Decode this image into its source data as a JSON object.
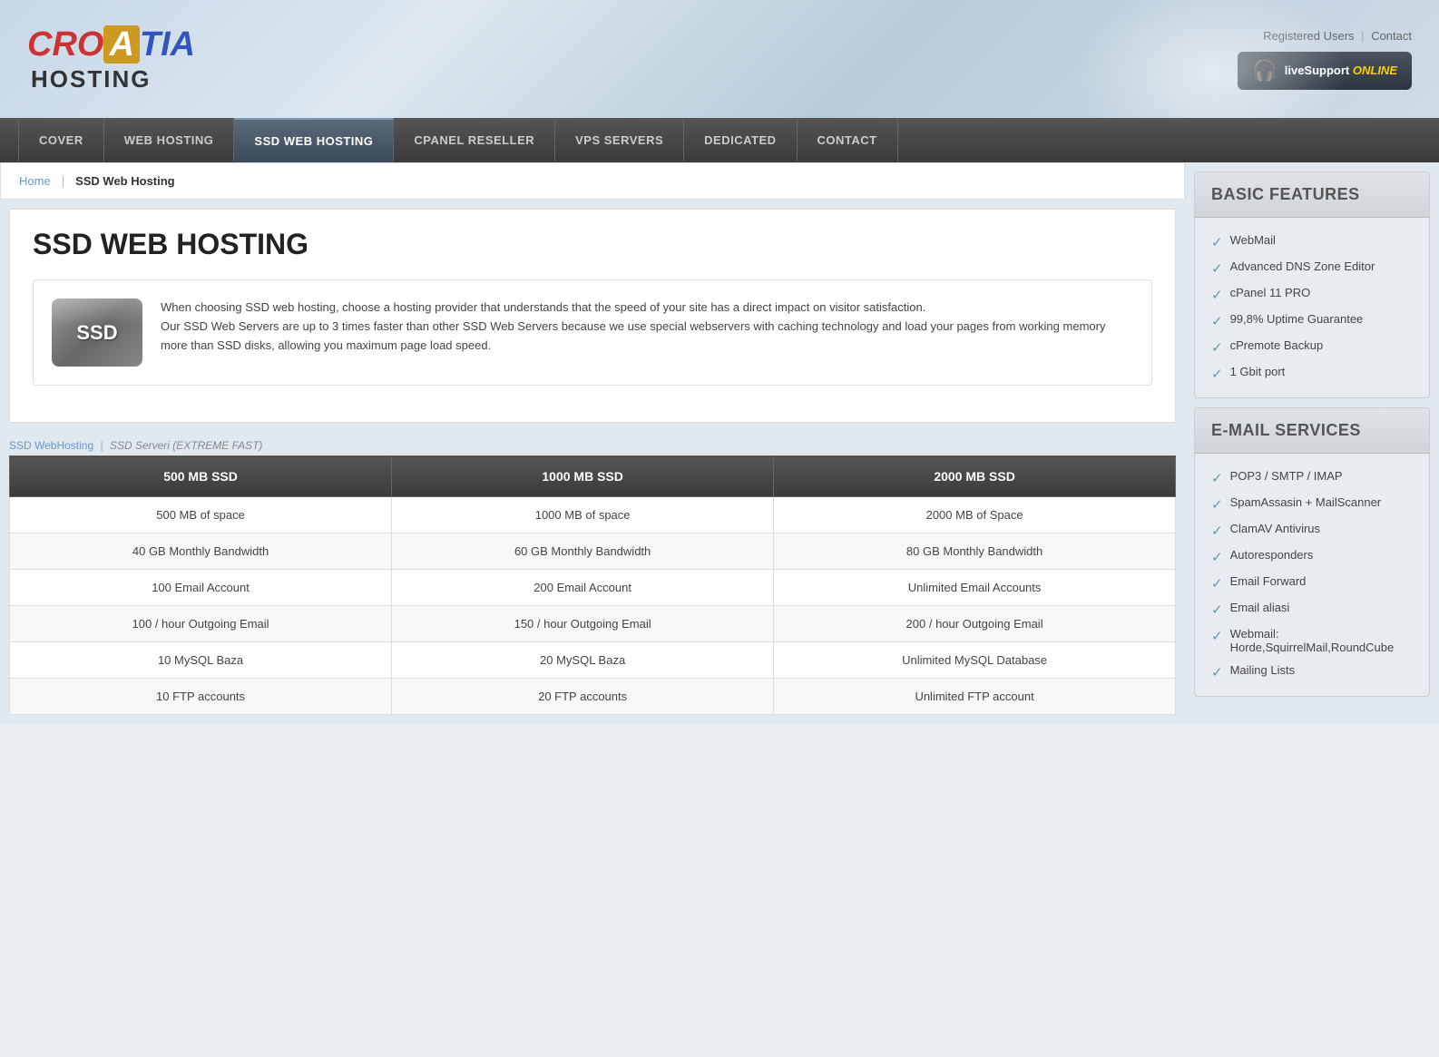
{
  "header": {
    "logo": {
      "cro": "CRO",
      "a": "A",
      "tia": "TIA",
      "hosting": "HOSTING"
    },
    "links": {
      "registered": "Registered Users",
      "separator": "|",
      "contact": "Contact"
    },
    "livesupport": {
      "label": "liveSupport",
      "status": "ONLINE"
    }
  },
  "nav": {
    "items": [
      {
        "label": "COVER",
        "active": false
      },
      {
        "label": "WEB HOSTING",
        "active": false
      },
      {
        "label": "SSD WEB HOSTING",
        "active": true
      },
      {
        "label": "CPANEL RESELLER",
        "active": false
      },
      {
        "label": "VPS SERVERS",
        "active": false
      },
      {
        "label": "DEDICATED",
        "active": false
      },
      {
        "label": "CONTACT",
        "active": false
      }
    ]
  },
  "breadcrumb": {
    "home": "Home",
    "current": "SSD Web Hosting"
  },
  "main": {
    "title": "SSD WEB HOSTING",
    "intro": {
      "icon_text": "SSD",
      "text": "When choosing SSD web hosting, choose a hosting provider that understands that the speed of your site has a direct impact on visitor satisfaction.\nOur SSD Web Servers are up to 3 times faster than other SSD Web Servers because we use special webservers with caching technology and load your pages from working memory more than SSD disks, allowing you maximum page load speed."
    },
    "table_links": {
      "link1": "SSD WebHosting",
      "separator": "|",
      "link2": "SSD Serveri (EXTREME FAST)"
    },
    "table": {
      "headers": [
        "500 MB SSD",
        "1000 MB SSD",
        "2000 MB SSD"
      ],
      "rows": [
        [
          "500 MB of space",
          "1000 MB of space",
          "2000 MB of Space"
        ],
        [
          "40 GB Monthly Bandwidth",
          "60 GB Monthly Bandwidth",
          "80 GB Monthly Bandwidth"
        ],
        [
          "100 Email Account",
          "200 Email Account",
          "Unlimited Email Accounts"
        ],
        [
          "100 / hour Outgoing Email",
          "150 / hour Outgoing Email",
          "200 / hour Outgoing Email"
        ],
        [
          "10 MySQL Baza",
          "20 MySQL Baza",
          "Unlimited MySQL Database"
        ],
        [
          "10 FTP accounts",
          "20 FTP accounts",
          "Unlimited FTP account"
        ]
      ]
    }
  },
  "sidebar": {
    "basic_features": {
      "title": "BASIC FEATURES",
      "items": [
        "WebMail",
        "Advanced DNS Zone Editor",
        "cPanel 11 PRO",
        "99,8% Uptime Guarantee",
        "cPremote Backup",
        "1 Gbit port"
      ]
    },
    "email_services": {
      "title": "E-MAIL SERVICES",
      "items": [
        "POP3 / SMTP / IMAP",
        "SpamAssasin + MailScanner",
        "ClamAV Antivirus",
        "Autoresponders",
        "Email Forward",
        "Email aliasi",
        "Webmail: Horde,SquirrelMail,RoundCube",
        "Mailing Lists"
      ]
    }
  }
}
